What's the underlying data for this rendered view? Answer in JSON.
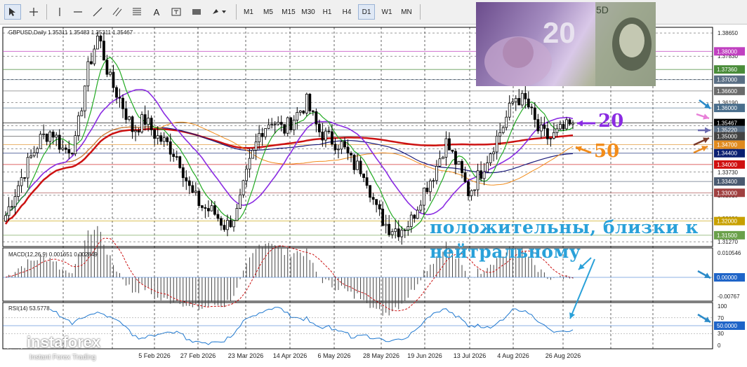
{
  "toolbar": {
    "timeframes": [
      "M1",
      "M5",
      "M15",
      "M30",
      "H1",
      "H4",
      "D1",
      "W1",
      "MN"
    ],
    "selected_timeframe": "D1",
    "tool_letter": "A"
  },
  "chart_header": "GBPUSD,Daily  1.35311 1.35483 1.35311 1.35467",
  "price_axis": {
    "ticks": [
      "1.38650",
      "1.37830",
      "1.37010",
      "1.36190",
      "1.35370",
      "1.34550",
      "1.33730",
      "1.32910",
      "1.32090",
      "1.31270"
    ]
  },
  "level_tags": [
    {
      "label": "1.38000",
      "value": 1.38,
      "color": "#c040c0"
    },
    {
      "label": "1.37360",
      "value": 1.3736,
      "color": "#4a8c3a"
    },
    {
      "label": "1.37000",
      "value": 1.37,
      "color": "#5a6e84"
    },
    {
      "label": "1.36600",
      "value": 1.366,
      "color": "#6b6b6b"
    },
    {
      "label": "1.36000",
      "value": 1.36,
      "color": "#4a6e8c"
    },
    {
      "label": "1.35467",
      "value": 1.35467,
      "color": "#000000"
    },
    {
      "label": "1.35220",
      "value": 1.3522,
      "color": "#5a6e84"
    },
    {
      "label": "1.35000",
      "value": 1.35,
      "color": "#444444"
    },
    {
      "label": "1.34700",
      "value": 1.347,
      "color": "#e08a1e"
    },
    {
      "label": "1.34400",
      "value": 1.344,
      "color": "#0a1e70"
    },
    {
      "label": "1.34000",
      "value": 1.34,
      "color": "#d01010"
    },
    {
      "label": "1.33400",
      "value": 1.334,
      "color": "#4a5a70"
    },
    {
      "label": "1.33000",
      "value": 1.33,
      "color": "#a04040"
    },
    {
      "label": "1.32000",
      "value": 1.32,
      "color": "#c8a000"
    },
    {
      "label": "1.31500",
      "value": 1.315,
      "color": "#6aa04a"
    }
  ],
  "macd": {
    "label": "MACD(12,26,9) 0.001651 0.002849",
    "ticks": [
      "0.010546",
      "0.00000",
      "-0.00767"
    ],
    "zero_tag": "0.00000"
  },
  "rsi": {
    "label": "RSI(14) 53.5778",
    "ticks": [
      "100",
      "70",
      "30",
      "0"
    ],
    "level_tag": "50.0000"
  },
  "dates": [
    "5 Feb 2026",
    "27 Feb 2026",
    "23 Mar 2026",
    "14 Apr 2026",
    "6 May 2026",
    "28 May 2026",
    "19 Jun 2026",
    "13 Jul 2026",
    "4 Aug 2026",
    "26 Aug 2026"
  ],
  "annotations": {
    "line1": "положительны, близки к",
    "line2": "нейтральному",
    "ma_fast": "20",
    "ma_slow": "50"
  },
  "logo": {
    "name": "instaforex",
    "tagline": "Instant Forex Trading"
  },
  "colors": {
    "ma_fast": "#8a2be2",
    "ma_slow": "#f28c1a",
    "annotation": "#2aa1d9",
    "ma200": "#cc1111",
    "ma_navy": "#1a1a7a",
    "ma_green": "#22aa22"
  },
  "chart_data": {
    "type": "candlestick",
    "symbol": "GBPUSD",
    "timeframe": "Daily",
    "last": {
      "open": 1.35311,
      "high": 1.35483,
      "low": 1.35311,
      "close": 1.35467
    },
    "ylim": [
      1.311,
      1.3885
    ],
    "key_levels": [
      1.38,
      1.3736,
      1.37,
      1.366,
      1.36,
      1.3522,
      1.35,
      1.347,
      1.344,
      1.34,
      1.334,
      1.33,
      1.32,
      1.315
    ],
    "price_path": [
      1.322,
      1.332,
      1.341,
      1.349,
      1.352,
      1.345,
      1.347,
      1.372,
      1.386,
      1.37,
      1.362,
      1.352,
      1.356,
      1.35,
      1.347,
      1.342,
      1.33,
      1.325,
      1.323,
      1.318,
      1.323,
      1.339,
      1.352,
      1.356,
      1.352,
      1.357,
      1.362,
      1.352,
      1.349,
      1.347,
      1.34,
      1.338,
      1.324,
      1.318,
      1.317,
      1.32,
      1.33,
      1.337,
      1.348,
      1.34,
      1.33,
      1.337,
      1.346,
      1.354,
      1.364,
      1.362,
      1.352,
      1.349,
      1.352,
      1.354
    ],
    "rsi_level": 50
  }
}
